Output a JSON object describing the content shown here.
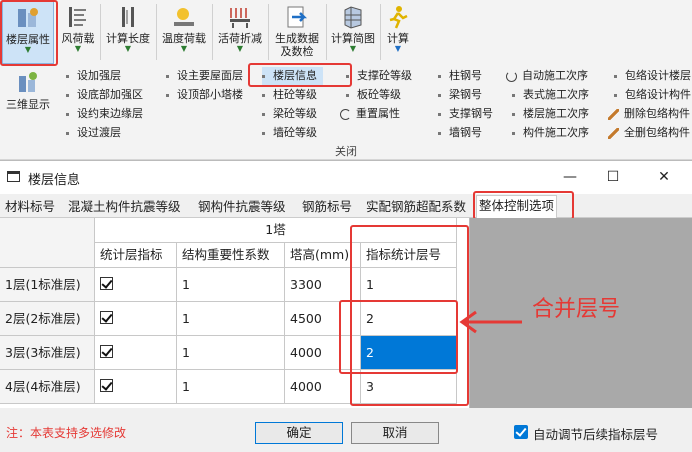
{
  "ribbon": {
    "big_buttons": [
      {
        "label1": "楼层属性",
        "label2": "",
        "icon": "floor-properties-icon"
      },
      {
        "label1": "风荷载",
        "label2": "",
        "icon": "wind-load-icon"
      },
      {
        "label1": "计算长度",
        "label2": "",
        "icon": "calc-length-icon"
      },
      {
        "label1": "温度荷载",
        "label2": "",
        "icon": "temperature-load-icon"
      },
      {
        "label1": "活荷折减",
        "label2": "",
        "icon": "live-load-reduction-icon"
      },
      {
        "label1": "生成数据",
        "label2": "及数检",
        "icon": "generate-data-icon"
      },
      {
        "label1": "计算简图",
        "label2": "",
        "icon": "calc-diagram-icon"
      },
      {
        "label1": "计算",
        "label2": "",
        "icon": "calculate-icon"
      }
    ],
    "three_d": "三维显示",
    "col1": [
      "设加强层",
      "设底部加强区",
      "设约束边缘层",
      "设过渡层"
    ],
    "col2": [
      "设主要屋面层",
      "设顶部小塔楼"
    ],
    "col3": [
      "楼层信息",
      "柱砼等级",
      "梁砼等级",
      "墙砼等级"
    ],
    "col4": [
      "支撑砼等级",
      "板砼等级",
      "重置属性"
    ],
    "col5": [
      "柱钢号",
      "梁钢号",
      "支撑钢号",
      "墙钢号"
    ],
    "col6": [
      "自动施工次序",
      "表式施工次序",
      "楼层施工次序",
      "构件施工次序"
    ],
    "col7": [
      "包络设计楼层",
      "包络设计构件",
      "删除包络构件",
      "全删包络构件"
    ],
    "close": "关闭"
  },
  "dialog": {
    "title": "楼层信息",
    "minimize": "—",
    "maximize": "☐",
    "close": "✕",
    "tabs": [
      "材料标号",
      "混凝土构件抗震等级",
      "钢构件抗震等级",
      "钢筋标号",
      "实配钢筋超配系数",
      "整体控制选项"
    ],
    "active_tab": "整体控制选项",
    "table": {
      "group_header": "1塔",
      "columns": [
        "统计层指标",
        "结构重要性系数",
        "塔高(mm)",
        "指标统计层号"
      ],
      "rows": [
        {
          "label": "1层(1标准层)",
          "checked": true,
          "importance": "1",
          "height": "3300",
          "stat_floor": "1"
        },
        {
          "label": "2层(2标准层)",
          "checked": true,
          "importance": "1",
          "height": "4500",
          "stat_floor": "2"
        },
        {
          "label": "3层(3标准层)",
          "checked": true,
          "importance": "1",
          "height": "4000",
          "stat_floor": "2"
        },
        {
          "label": "4层(4标准层)",
          "checked": true,
          "importance": "1",
          "height": "4000",
          "stat_floor": "3"
        }
      ]
    },
    "annotation": "合并层号",
    "note": "注：本表支持多选修改",
    "ok": "确定",
    "cancel": "取消",
    "auto_adjust": "自动调节后续指标层号"
  }
}
